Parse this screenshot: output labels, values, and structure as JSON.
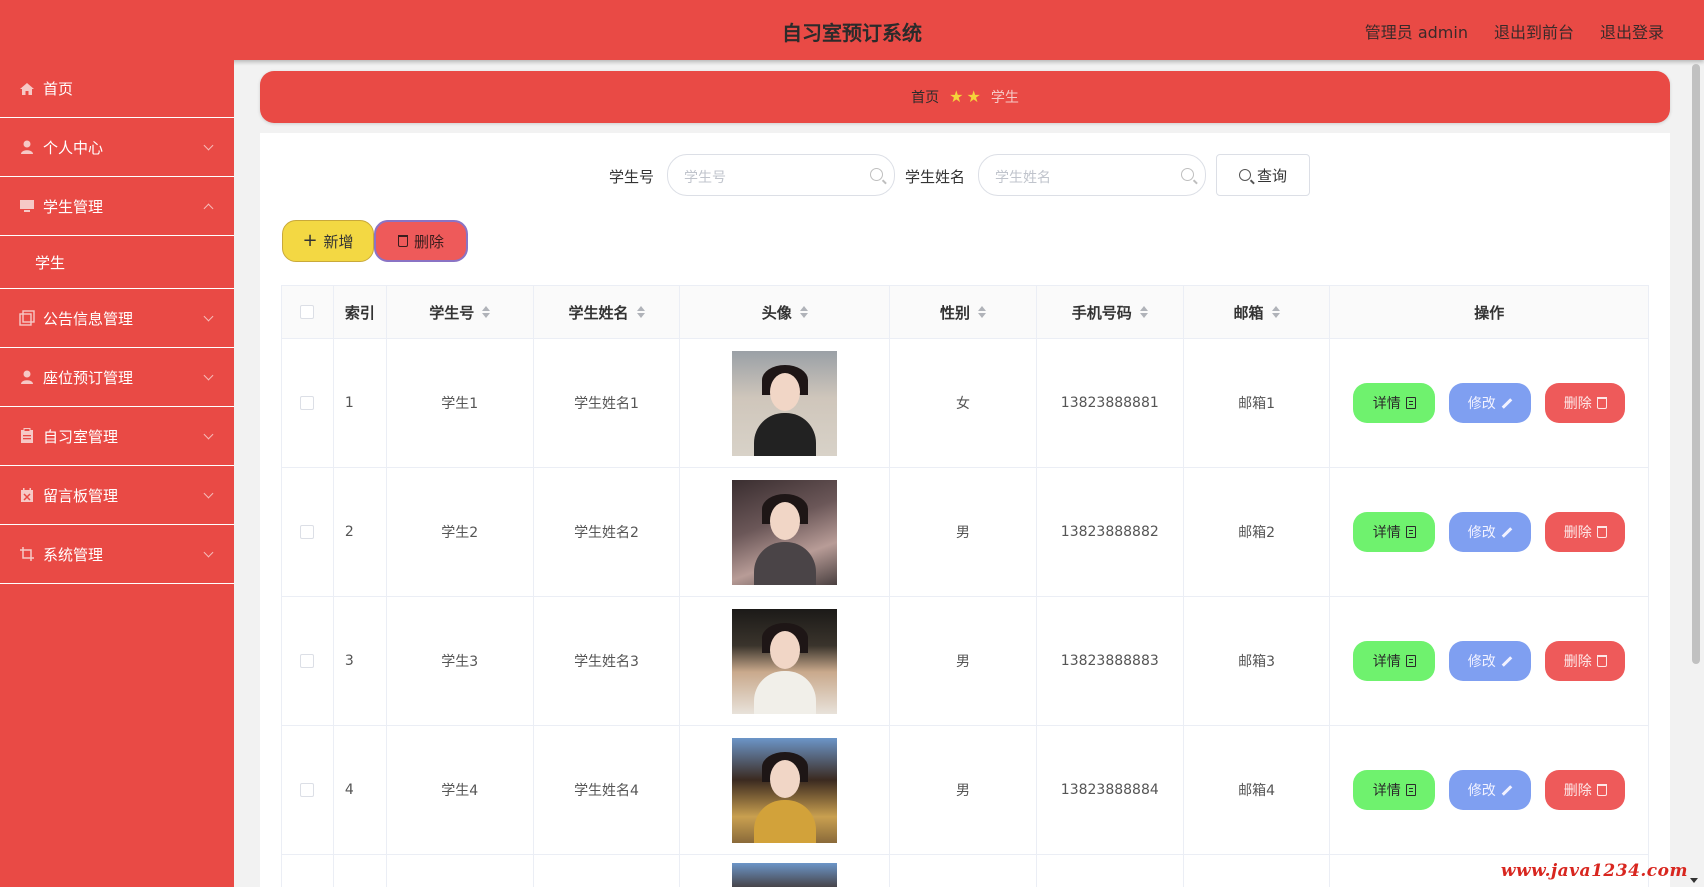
{
  "app": {
    "title": "自习室预订系统"
  },
  "header": {
    "admin": "管理员 admin",
    "to_frontend": "退出到前台",
    "logout": "退出登录"
  },
  "sidebar": {
    "items": [
      {
        "label": "首页",
        "icon": "home-icon"
      },
      {
        "label": "个人中心",
        "icon": "user-icon"
      },
      {
        "label": "学生管理",
        "icon": "monitor-icon"
      },
      {
        "label": "学生",
        "icon": ""
      },
      {
        "label": "公告信息管理",
        "icon": "copy-icon"
      },
      {
        "label": "座位预订管理",
        "icon": "user-icon"
      },
      {
        "label": "自习室管理",
        "icon": "clipboard-icon"
      },
      {
        "label": "留言板管理",
        "icon": "calendar-icon"
      },
      {
        "label": "系统管理",
        "icon": "crop-icon"
      }
    ]
  },
  "breadcrumb": {
    "home": "首页",
    "current": "学生",
    "star": "★"
  },
  "search": {
    "student_no_label": "学生号",
    "student_no_placeholder": "学生号",
    "student_name_label": "学生姓名",
    "student_name_placeholder": "学生姓名",
    "query_label": "查询"
  },
  "actions": {
    "add_label": "新增",
    "delete_label": "删除",
    "add_icon": "+"
  },
  "table": {
    "headers": [
      "索引",
      "学生号",
      "学生姓名",
      "头像",
      "性别",
      "手机号码",
      "邮箱",
      "操作"
    ],
    "rows": [
      {
        "index": "1",
        "student_no": "学生1",
        "name": "学生姓名1",
        "gender": "女",
        "phone": "13823888881",
        "email": "邮箱1"
      },
      {
        "index": "2",
        "student_no": "学生2",
        "name": "学生姓名2",
        "gender": "男",
        "phone": "13823888882",
        "email": "邮箱2"
      },
      {
        "index": "3",
        "student_no": "学生3",
        "name": "学生姓名3",
        "gender": "男",
        "phone": "13823888883",
        "email": "邮箱3"
      },
      {
        "index": "4",
        "student_no": "学生4",
        "name": "学生姓名4",
        "gender": "男",
        "phone": "13823888884",
        "email": "邮箱4"
      }
    ],
    "row_actions": {
      "detail": "详情",
      "edit": "修改",
      "delete": "删除"
    }
  },
  "watermark": "www.java1234.com",
  "colors": {
    "primary": "#e94a45",
    "detail": "#6ff26e",
    "edit": "#7f9ff1",
    "delete": "#ee5a5a",
    "add": "#f3d843"
  }
}
